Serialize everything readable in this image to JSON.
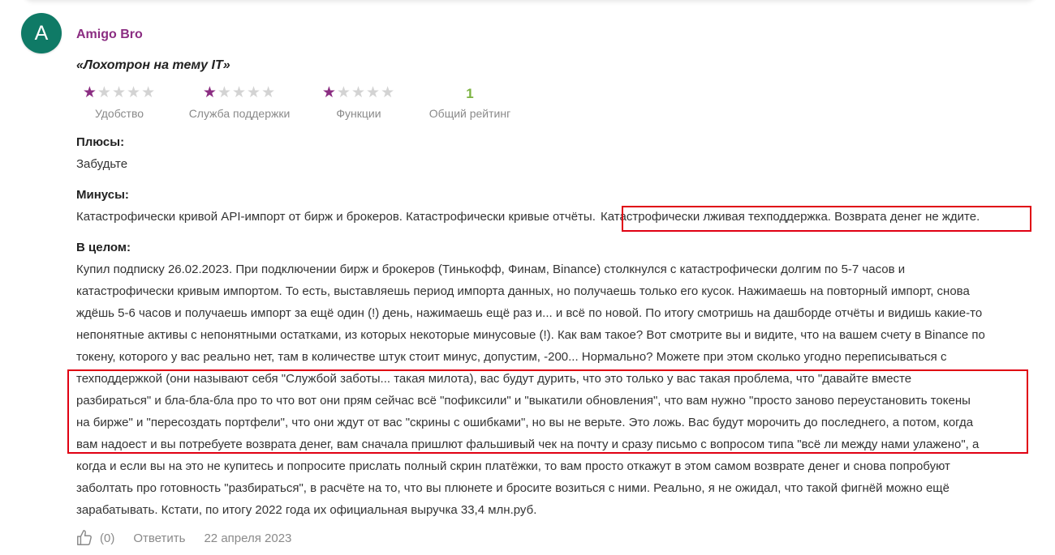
{
  "review": {
    "avatar_letter": "A",
    "author": "Amigo Bro",
    "title": "«Лохотрон на тему IT»",
    "ratings": [
      {
        "label": "Удобство",
        "stars": 1,
        "max": 5
      },
      {
        "label": "Служба поддержки",
        "stars": 1,
        "max": 5
      },
      {
        "label": "Функции",
        "stars": 1,
        "max": 5
      }
    ],
    "overall": {
      "value": "1",
      "label": "Общий рейтинг"
    },
    "pros": {
      "label": "Плюсы:",
      "text": "Забудьте"
    },
    "cons": {
      "label": "Минусы:",
      "text_plain": "Катастрофически кривой API-импорт от бирж и брокеров. Катастрофически кривые отчёты.",
      "text_highlighted": "Катастрофически лживая техподдержка. Возврата денег не ждите."
    },
    "summary": {
      "label": "В целом:",
      "lines": [
        "Купил подписку 26.02.2023. При подключении бирж и брокеров (Тинькофф, Финам, Binance) столкнулся с катастрофически долгим по 5-7 часов и",
        "катастрофически кривым импортом. То есть, выставляешь период импорта данных, но получаешь только его кусок. Нажимаешь на повторный импорт, снова",
        "ждёшь 5-6 часов и получаешь импорт за ещё один (!) день, нажимаешь ещё раз и... и всё по новой. По итогу смотришь на дашборде отчёты и видишь какие-то",
        "непонятные активы с непонятными остатками, из которых некоторые минусовые (!). Как вам такое? Вот смотрите вы и видите, что на вашем счету в Binance по",
        "токену, которого у вас реально нет, там в количестве штук стоит минус, допустим, -200... Нормально? Можете при этом сколько угодно переписываться с",
        "техподдержкой (они называют себя \"Службой заботы... такая милота), вас будут дурить, что это только у вас такая проблема, что \"давайте вместе",
        "разбираться\" и бла-бла-бла про то что вот они прям сейчас всё \"пофиксили\" и \"выкатили обновления\", что вам нужно \"просто заново переустановить токены",
        "на бирже\" и \"пересоздать портфели\", что они ждут от вас \"скрины с ошибками\", но вы не верьте. Это ложь. Вас будут морочить до последнего, а потом, когда",
        "вам надоест и вы потребуете возврата денег, вам сначала пришлют фальшивый чек на почту и сразу письмо с вопросом типа \"всё ли между нами улажено\", а",
        "когда и если вы на это не купитесь и попросите прислать полный скрин платёжки, то вам просто откажут в этом самом возврате денег и снова попробуют",
        "заболтать про готовность \"разбираться\", в расчёте на то, что вы плюнете и бросите возиться с ними. Реально, я не ожидал, что такой фигнёй можно ещё",
        "зарабатывать. Кстати, по итогу 2022 года их официальная выручка 33,4 млн.руб."
      ]
    },
    "footer": {
      "like_count": "(0)",
      "reply_label": "Ответить",
      "date": "22 апреля 2023"
    }
  },
  "colors": {
    "accent": "#8b2d82",
    "avatar_bg": "#0f7a66",
    "overall_rating": "#7cb342",
    "highlight_border": "#e00012"
  }
}
